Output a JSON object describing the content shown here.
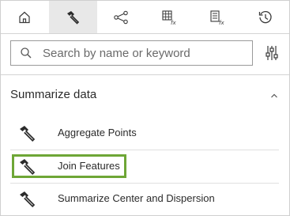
{
  "tabs": [
    {
      "name": "home",
      "icon": "home-icon",
      "active": false
    },
    {
      "name": "tools",
      "icon": "hammer-icon",
      "active": true
    },
    {
      "name": "models",
      "icon": "model-graph-icon",
      "active": false
    },
    {
      "name": "table-functions",
      "icon": "table-fx-icon",
      "active": false
    },
    {
      "name": "list-functions",
      "icon": "list-fx-icon",
      "active": false
    },
    {
      "name": "history",
      "icon": "history-icon",
      "active": false
    }
  ],
  "search": {
    "placeholder": "Search by name or keyword",
    "value": ""
  },
  "section": {
    "title": "Summarize data",
    "expanded": true
  },
  "tools": [
    {
      "label": "Aggregate Points",
      "icon": "hammer-icon"
    },
    {
      "label": "Join Features",
      "icon": "hammer-icon",
      "highlighted": true
    },
    {
      "label": "Summarize Center and Dispersion",
      "icon": "hammer-icon"
    }
  ],
  "colors": {
    "active_tab_bg": "#e8e8e8",
    "highlight": "#6ea636",
    "border": "#d4d4d4"
  }
}
